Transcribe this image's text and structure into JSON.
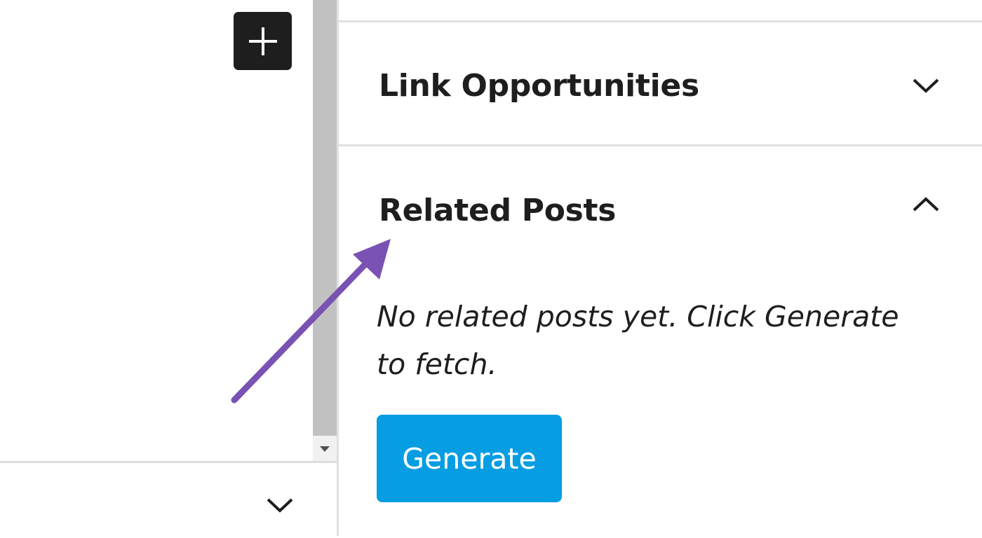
{
  "editor": {
    "add_block_icon": "plus-icon"
  },
  "sidebar": {
    "panels": [
      {
        "title": "Link Opportunities",
        "state": "collapsed",
        "chevron_icon": "chevron-down-icon"
      },
      {
        "title": "Related Posts",
        "state": "expanded",
        "chevron_icon": "chevron-up-icon"
      }
    ],
    "related_posts": {
      "empty_message": "No related posts yet. Click Generate to fetch.",
      "generate_label": "Generate"
    }
  },
  "bottom_panel": {
    "chevron_icon": "chevron-down-icon"
  },
  "colors": {
    "accent_button": "#069de3",
    "annotation_arrow": "#7952b3",
    "dark_button": "#1e1e1e"
  }
}
